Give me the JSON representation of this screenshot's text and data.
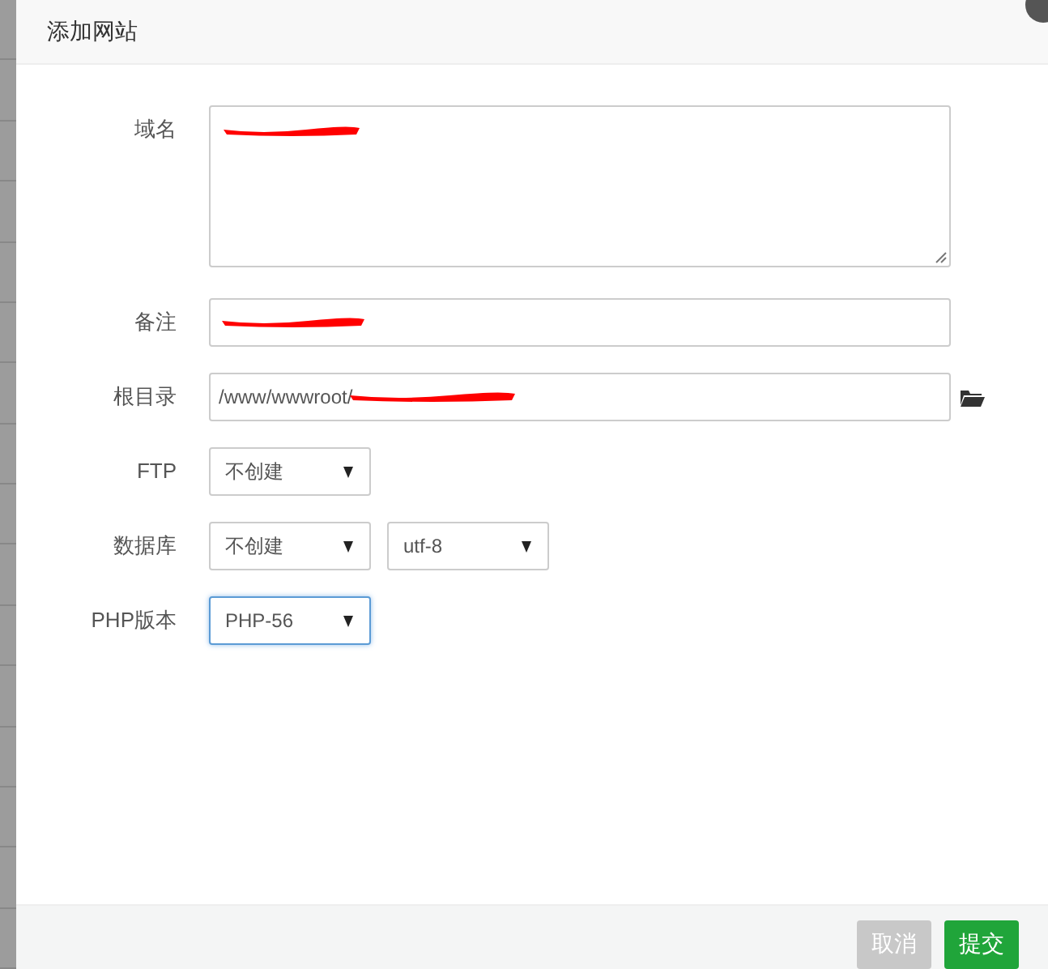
{
  "dialog": {
    "title": "添加网站"
  },
  "fields": [
    {
      "kind": "textarea",
      "label": "域名",
      "redacted": true
    },
    {
      "kind": "text",
      "label": "备注",
      "redacted": true
    },
    {
      "kind": "path",
      "label": "根目录",
      "value": "/www/wwwroot/",
      "redacted": true
    },
    {
      "kind": "select",
      "label": "FTP",
      "selects": [
        {
          "value": "不创建",
          "focused": false
        }
      ]
    },
    {
      "kind": "select",
      "label": "数据库",
      "selects": [
        {
          "value": "不创建",
          "focused": false
        },
        {
          "value": "utf-8",
          "focused": false
        }
      ]
    },
    {
      "kind": "select",
      "label": "PHP版本",
      "selects": [
        {
          "value": "PHP-56",
          "focused": true
        }
      ]
    }
  ],
  "buttons": [
    {
      "label": "取消",
      "kind": "cancel"
    },
    {
      "label": "提交",
      "kind": "submit"
    }
  ]
}
